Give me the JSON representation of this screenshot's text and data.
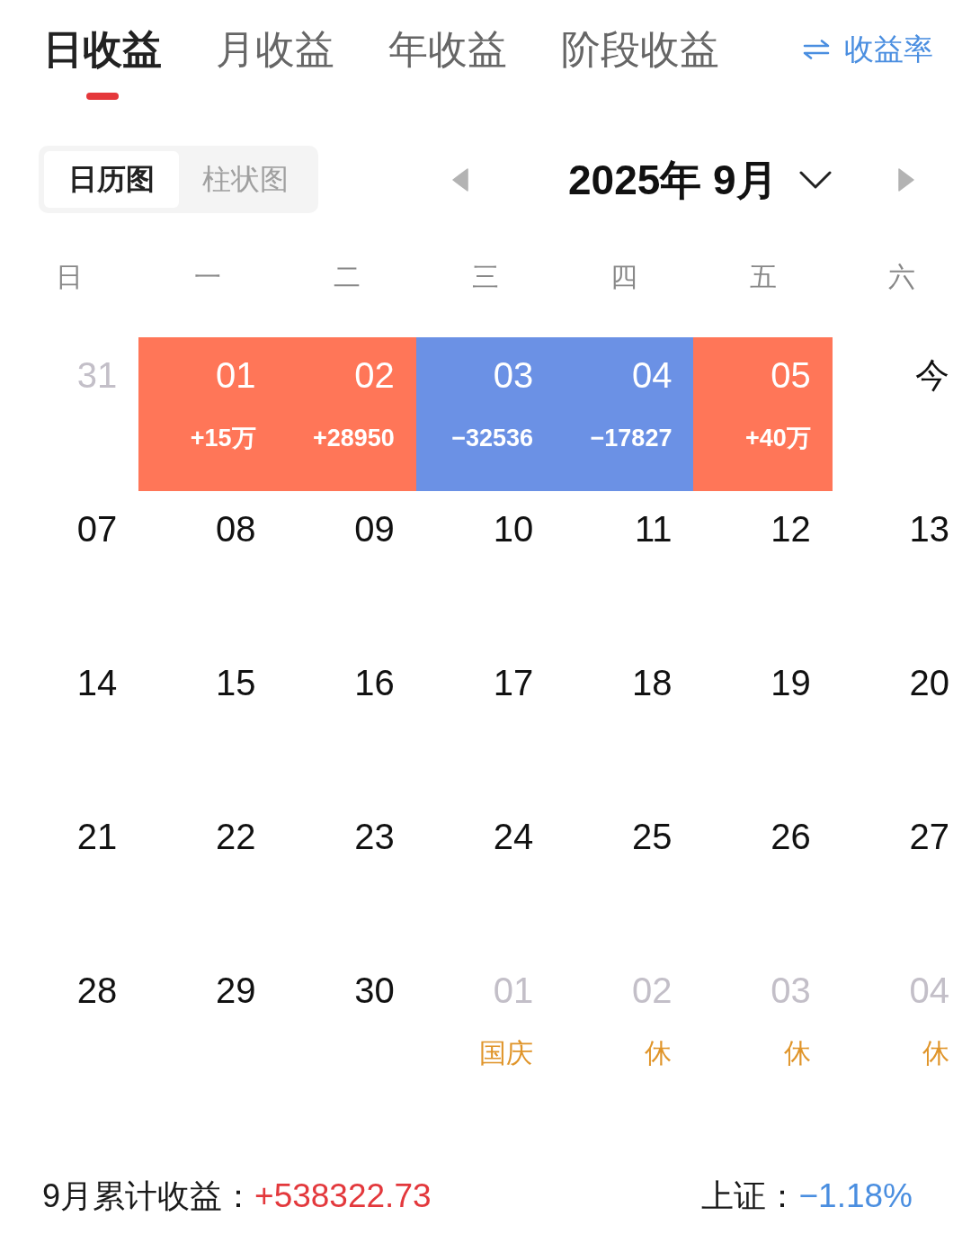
{
  "tabs": [
    {
      "label": "日收益",
      "selected": true
    },
    {
      "label": "月收益",
      "selected": false
    },
    {
      "label": "年收益",
      "selected": false
    },
    {
      "label": "阶段收益",
      "selected": false
    }
  ],
  "rate_switch": {
    "label": "收益率"
  },
  "view_toggle": [
    {
      "label": "日历图",
      "selected": true
    },
    {
      "label": "柱状图",
      "selected": false
    }
  ],
  "month_picker": {
    "label": "2025年 9月"
  },
  "weekdays": [
    "日",
    "一",
    "二",
    "三",
    "四",
    "五",
    "六"
  ],
  "weeks": [
    [
      {
        "day": "31",
        "kind": "other"
      },
      {
        "day": "01",
        "kind": "trade",
        "amount": "+15万",
        "color": "#ff7658"
      },
      {
        "day": "02",
        "kind": "trade",
        "amount": "+28950",
        "color": "#ff7658"
      },
      {
        "day": "03",
        "kind": "trade",
        "amount": "−32536",
        "color": "#6b91e5"
      },
      {
        "day": "04",
        "kind": "trade",
        "amount": "−17827",
        "color": "#6b91e5"
      },
      {
        "day": "05",
        "kind": "trade",
        "amount": "+40万",
        "color": "#ff7658"
      },
      {
        "day": "今",
        "kind": "today"
      }
    ],
    [
      {
        "day": "07",
        "kind": "day"
      },
      {
        "day": "08",
        "kind": "day"
      },
      {
        "day": "09",
        "kind": "day"
      },
      {
        "day": "10",
        "kind": "day"
      },
      {
        "day": "11",
        "kind": "day"
      },
      {
        "day": "12",
        "kind": "day"
      },
      {
        "day": "13",
        "kind": "day"
      }
    ],
    [
      {
        "day": "14",
        "kind": "day"
      },
      {
        "day": "15",
        "kind": "day"
      },
      {
        "day": "16",
        "kind": "day"
      },
      {
        "day": "17",
        "kind": "day"
      },
      {
        "day": "18",
        "kind": "day"
      },
      {
        "day": "19",
        "kind": "day"
      },
      {
        "day": "20",
        "kind": "day"
      }
    ],
    [
      {
        "day": "21",
        "kind": "day"
      },
      {
        "day": "22",
        "kind": "day"
      },
      {
        "day": "23",
        "kind": "day"
      },
      {
        "day": "24",
        "kind": "day"
      },
      {
        "day": "25",
        "kind": "day"
      },
      {
        "day": "26",
        "kind": "day"
      },
      {
        "day": "27",
        "kind": "day"
      }
    ],
    [
      {
        "day": "28",
        "kind": "day"
      },
      {
        "day": "29",
        "kind": "day"
      },
      {
        "day": "30",
        "kind": "day"
      },
      {
        "day": "01",
        "kind": "other",
        "note": "国庆"
      },
      {
        "day": "02",
        "kind": "other",
        "note": "休"
      },
      {
        "day": "03",
        "kind": "other",
        "note": "休"
      },
      {
        "day": "04",
        "kind": "other",
        "note": "休"
      }
    ]
  ],
  "footer": {
    "summary": {
      "label": "9月累计收益：",
      "value": "+538322.73",
      "gain": true
    },
    "index": {
      "label": "上证：",
      "value": "−1.18%",
      "gain": false
    }
  }
}
